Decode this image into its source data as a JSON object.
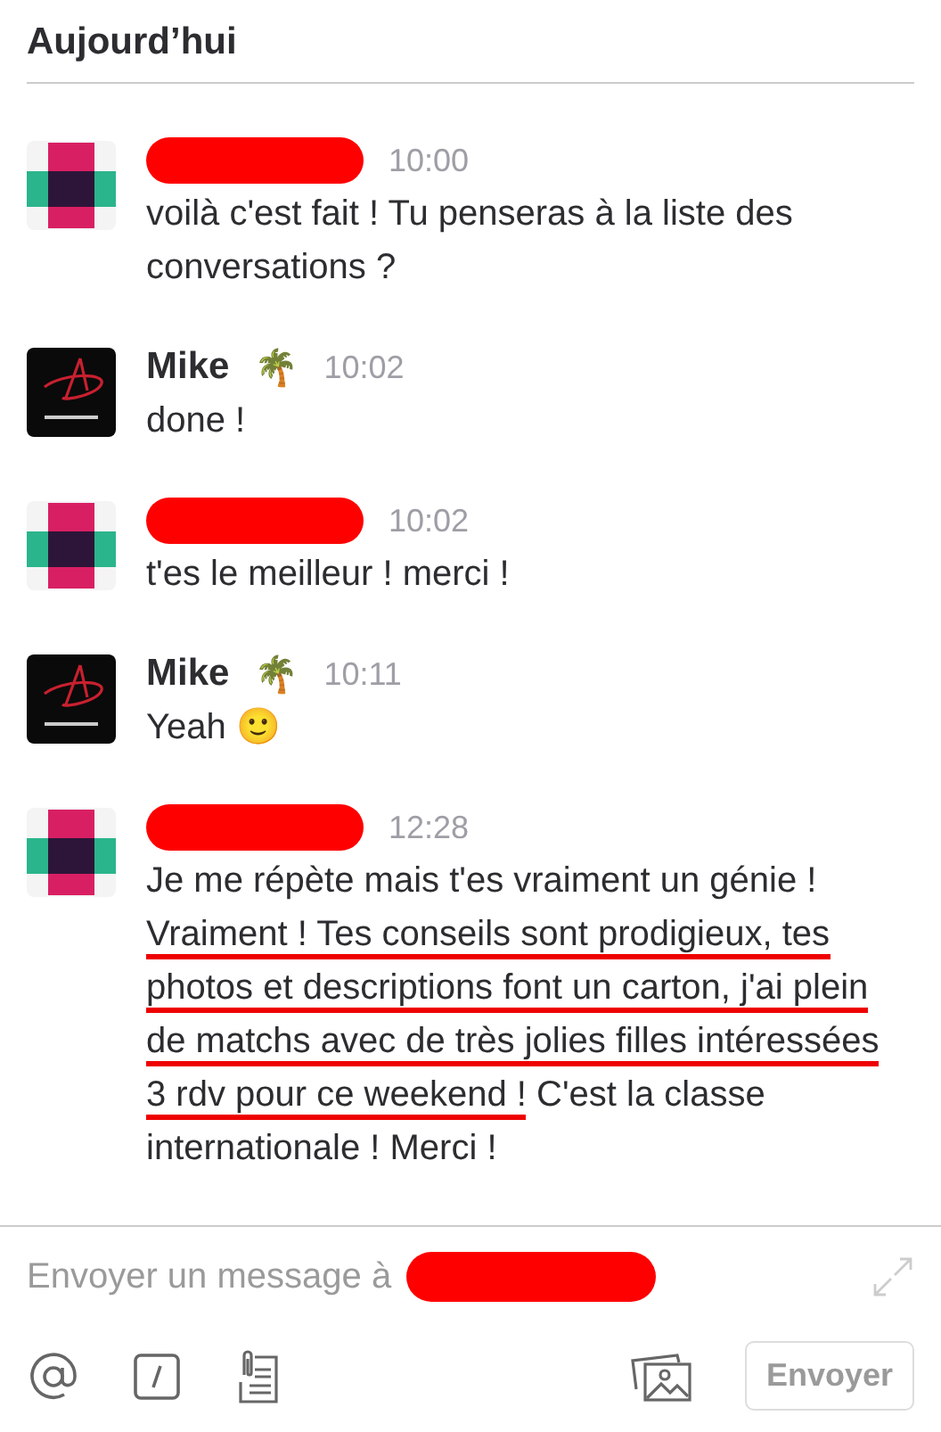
{
  "header": {
    "title": "Aujourd’hui"
  },
  "messages": [
    {
      "kind": "squares",
      "author_redacted": true,
      "time": "10:00",
      "text": "voilà c'est fait ! Tu penseras à la liste des conversations ?"
    },
    {
      "kind": "logo",
      "author": "Mike",
      "author_redacted": false,
      "badge": "🌴",
      "time": "10:02",
      "text": "done !"
    },
    {
      "kind": "squares",
      "author_redacted": true,
      "time": "10:02",
      "text": "t'es le meilleur ! merci !"
    },
    {
      "kind": "logo",
      "author": "Mike",
      "author_redacted": false,
      "badge": "🌴",
      "time": "10:11",
      "text": "Yeah 🙂"
    },
    {
      "kind": "squares",
      "author_redacted": true,
      "time": "12:28",
      "segments": [
        {
          "text": "Je me répète mais t'es vraiment un génie ! ",
          "underlined": false
        },
        {
          "text": "Vraiment ! Tes conseils sont prodigieux, tes photos et descriptions font un carton, j'ai plein de matchs avec de très jolies filles intéressées 3 rdv pour ce weekend !",
          "underlined": true
        },
        {
          "text": " C'est la classe internationale ! Merci !",
          "underlined": false
        }
      ]
    }
  ],
  "composer": {
    "placeholder": "Envoyer un message à",
    "recipient_redacted": true,
    "send_label": "Envoyer"
  }
}
